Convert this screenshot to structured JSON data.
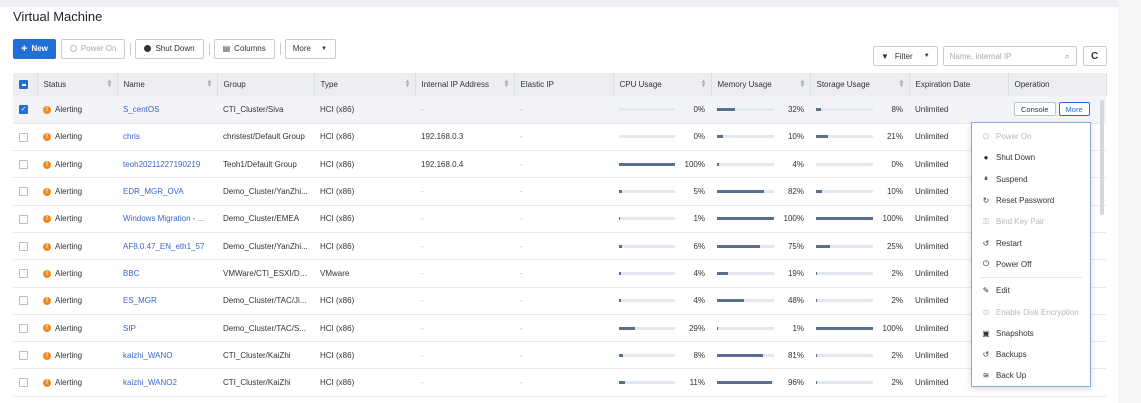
{
  "page": {
    "title": "Virtual Machine"
  },
  "toolbar": {
    "new_label": "New",
    "power_on_label": "Power On",
    "shut_down_label": "Shut Down",
    "columns_label": "Columns",
    "more_label": "More",
    "filter_label": "Filter",
    "search_placeholder": "Name, internal IP"
  },
  "columns": [
    "Status",
    "Name",
    "Group",
    "Type",
    "Internal IP Address",
    "Elastic IP",
    "CPU Usage",
    "Memory Usage",
    "Storage Usage",
    "Expiration Date",
    "Operation"
  ],
  "rows": [
    {
      "status": "Alerting",
      "name": "S_centOS",
      "group": "CTI_Cluster/Siva",
      "type": "HCI (x86)",
      "ip": "-",
      "eip": "-",
      "cpu": 0,
      "cpu_label": "0%",
      "mem": 32,
      "mem_label": "32%",
      "sto": 8,
      "sto_label": "8%",
      "exp": "Unlimited",
      "checked": true
    },
    {
      "status": "Alerting",
      "name": "chris",
      "group": "christest/Default Group",
      "type": "HCI (x86)",
      "ip": "192.168.0.3",
      "eip": "-",
      "cpu": 0,
      "cpu_label": "0%",
      "mem": 10,
      "mem_label": "10%",
      "sto": 21,
      "sto_label": "21%",
      "exp": "Unlimited",
      "checked": false
    },
    {
      "status": "Alerting",
      "name": "teoh20211227190219",
      "group": "Teoh1/Default Group",
      "type": "HCI (x86)",
      "ip": "192.168.0.4",
      "eip": "-",
      "cpu": 100,
      "cpu_label": "100%",
      "mem": 4,
      "mem_label": "4%",
      "sto": 0,
      "sto_label": "0%",
      "exp": "Unlimited",
      "checked": false
    },
    {
      "status": "Alerting",
      "name": "EDR_MGR_OVA",
      "group": "Demo_Cluster/YanZhi...",
      "type": "HCI (x86)",
      "ip": "-",
      "eip": "-",
      "cpu": 5,
      "cpu_label": "5%",
      "mem": 82,
      "mem_label": "82%",
      "sto": 10,
      "sto_label": "10%",
      "exp": "Unlimited",
      "checked": false
    },
    {
      "status": "Alerting",
      "name": "Windows Migration - ...",
      "group": "Demo_Cluster/EMEA",
      "type": "HCI (x86)",
      "ip": "-",
      "eip": "-",
      "cpu": 1,
      "cpu_label": "1%",
      "mem": 100,
      "mem_label": "100%",
      "sto": 100,
      "sto_label": "100%",
      "exp": "Unlimited",
      "checked": false
    },
    {
      "status": "Alerting",
      "name": "AF8.0.47_EN_eth1_57",
      "group": "Demo_Cluster/YanZhi...",
      "type": "HCI (x86)",
      "ip": "-",
      "eip": "-",
      "cpu": 6,
      "cpu_label": "6%",
      "mem": 75,
      "mem_label": "75%",
      "sto": 25,
      "sto_label": "25%",
      "exp": "Unlimited",
      "checked": false
    },
    {
      "status": "Alerting",
      "name": "BBC",
      "group": "VMWare/CTI_ESXI/Di...",
      "type": "VMware",
      "ip": "-",
      "eip": "-",
      "cpu": 4,
      "cpu_label": "4%",
      "mem": 19,
      "mem_label": "19%",
      "sto": 2,
      "sto_label": "2%",
      "exp": "Unlimited",
      "checked": false
    },
    {
      "status": "Alerting",
      "name": "ES_MGR",
      "group": "Demo_Cluster/TAC/Ji...",
      "type": "HCI (x86)",
      "ip": "-",
      "eip": "-",
      "cpu": 4,
      "cpu_label": "4%",
      "mem": 48,
      "mem_label": "48%",
      "sto": 2,
      "sto_label": "2%",
      "exp": "Unlimited",
      "checked": false
    },
    {
      "status": "Alerting",
      "name": "SIP",
      "group": "Demo_Cluster/TAC/S...",
      "type": "HCI (x86)",
      "ip": "-",
      "eip": "-",
      "cpu": 29,
      "cpu_label": "29%",
      "mem": 1,
      "mem_label": "1%",
      "sto": 100,
      "sto_label": "100%",
      "exp": "Unlimited",
      "checked": false
    },
    {
      "status": "Alerting",
      "name": "kaizhi_WANO",
      "group": "CTI_Cluster/KaiZhi",
      "type": "HCI (x86)",
      "ip": "-",
      "eip": "-",
      "cpu": 8,
      "cpu_label": "8%",
      "mem": 81,
      "mem_label": "81%",
      "sto": 2,
      "sto_label": "2%",
      "exp": "Unlimited",
      "checked": false
    },
    {
      "status": "Alerting",
      "name": "kaizhi_WANO2",
      "group": "CTI_Cluster/KaiZhi",
      "type": "HCI (x86)",
      "ip": "-",
      "eip": "-",
      "cpu": 11,
      "cpu_label": "11%",
      "mem": 96,
      "mem_label": "96%",
      "sto": 2,
      "sto_label": "2%",
      "exp": "Unlimited",
      "checked": false
    }
  ],
  "row_ops": {
    "console_label": "Console",
    "more_label": "More"
  },
  "menu": [
    {
      "label": "Power On",
      "icon": "power-on-icon",
      "glyph": "⏻",
      "disabled": true
    },
    {
      "label": "Shut Down",
      "icon": "shutdown-icon",
      "glyph": "●",
      "disabled": false
    },
    {
      "label": "Suspend",
      "icon": "suspend-icon",
      "glyph": "⏸",
      "disabled": false
    },
    {
      "label": "Reset Password",
      "icon": "reset-password-icon",
      "glyph": "↻",
      "disabled": false
    },
    {
      "label": "Bind Key Pair",
      "icon": "key-icon",
      "glyph": "⚿",
      "disabled": true
    },
    {
      "label": "Restart",
      "icon": "restart-icon",
      "glyph": "↺",
      "disabled": false
    },
    {
      "label": "Power Off",
      "icon": "power-off-icon",
      "glyph": "⏻",
      "disabled": false
    },
    {
      "sep": true
    },
    {
      "label": "Edit",
      "icon": "edit-icon",
      "glyph": "✎",
      "disabled": false
    },
    {
      "label": "Enable Disk Encryption",
      "icon": "encryption-icon",
      "glyph": "⊙",
      "disabled": true
    },
    {
      "label": "Snapshots",
      "icon": "snapshot-icon",
      "glyph": "▣",
      "disabled": false
    },
    {
      "label": "Backups",
      "icon": "backup-icon",
      "glyph": "↺",
      "disabled": false
    },
    {
      "label": "Back Up",
      "icon": "backup-stack-icon",
      "glyph": "≋",
      "disabled": false
    }
  ]
}
